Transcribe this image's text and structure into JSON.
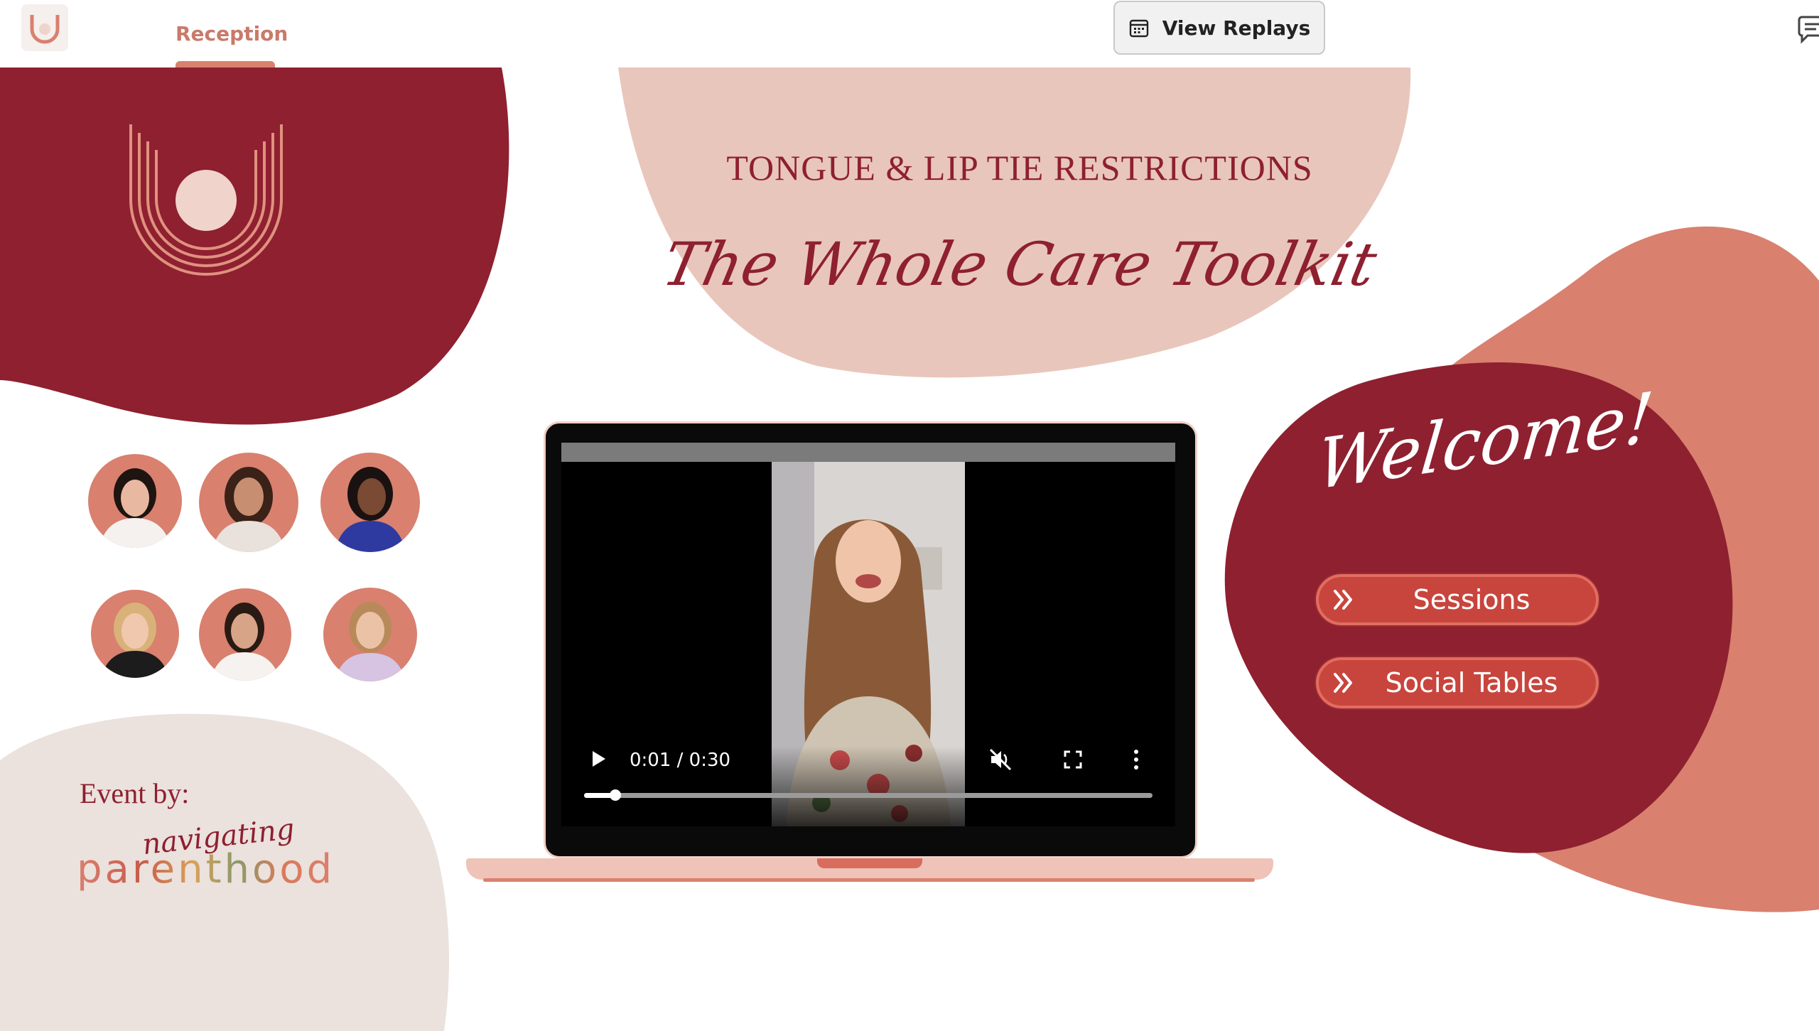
{
  "topbar": {
    "tab_label": "Reception",
    "view_replays_label": "View Replays",
    "icons": {
      "logo": "brand-logo-icon",
      "calendar": "calendar-icon",
      "chat": "chat-icon"
    }
  },
  "hero": {
    "title": "TONGUE & LIP TIE RESTRICTIONS",
    "subtitle": "The Whole Care Toolkit"
  },
  "welcome": {
    "text": "Welcome!",
    "buttons": [
      {
        "label": "Sessions",
        "icon": "double-chevron-right-icon"
      },
      {
        "label": "Social Tables",
        "icon": "double-chevron-right-icon"
      }
    ]
  },
  "video": {
    "time_display": "0:01 / 0:30",
    "progress": 0.055,
    "muted": true,
    "icons": {
      "play": "play-icon",
      "mute": "volume-muted-icon",
      "fullscreen": "fullscreen-icon",
      "more": "more-vertical-icon"
    }
  },
  "speakers": {
    "count": 6
  },
  "event_by": {
    "label": "Event by:",
    "organizer_script": "navigating",
    "organizer_word": "parenthood"
  },
  "colors": {
    "burgundy": "#8e2030",
    "salmon": "#d9806f",
    "blush": "#e9c6bb",
    "beige": "#ebe1dd",
    "button_red": "#c8453d"
  }
}
